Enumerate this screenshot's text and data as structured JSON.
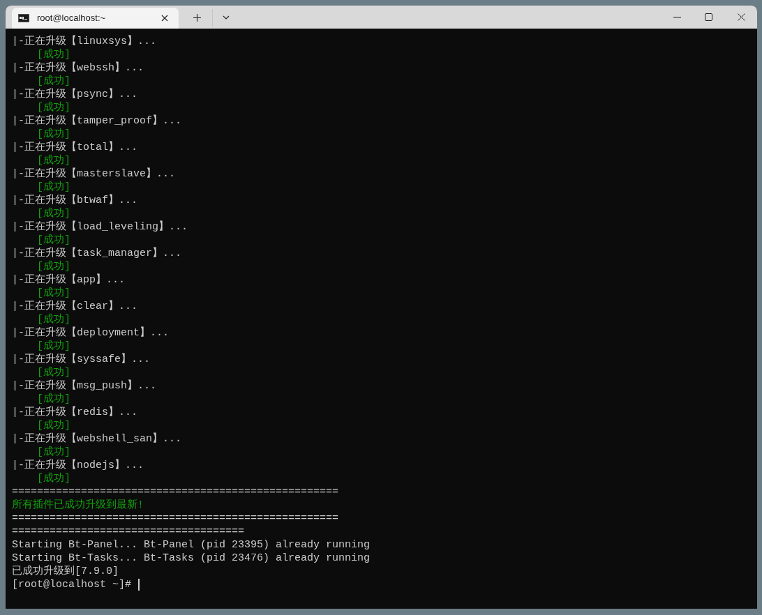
{
  "window": {
    "tab": {
      "title": "root@localhost:~",
      "selected": true
    }
  },
  "terminal": {
    "lines": [
      {
        "kind": "progress",
        "text": "|-正在升级【linuxsys】..."
      },
      {
        "kind": "status",
        "text": "[成功]"
      },
      {
        "kind": "progress",
        "text": "|-正在升级【webssh】..."
      },
      {
        "kind": "status",
        "text": "[成功]"
      },
      {
        "kind": "progress",
        "text": "|-正在升级【psync】..."
      },
      {
        "kind": "status",
        "text": "[成功]"
      },
      {
        "kind": "progress",
        "text": "|-正在升级【tamper_proof】..."
      },
      {
        "kind": "status",
        "text": "[成功]"
      },
      {
        "kind": "progress",
        "text": "|-正在升级【total】..."
      },
      {
        "kind": "status",
        "text": "[成功]"
      },
      {
        "kind": "progress",
        "text": "|-正在升级【masterslave】..."
      },
      {
        "kind": "status",
        "text": "[成功]"
      },
      {
        "kind": "progress",
        "text": "|-正在升级【btwaf】..."
      },
      {
        "kind": "status",
        "text": "[成功]"
      },
      {
        "kind": "progress",
        "text": "|-正在升级【load_leveling】..."
      },
      {
        "kind": "status",
        "text": "[成功]"
      },
      {
        "kind": "progress",
        "text": "|-正在升级【task_manager】..."
      },
      {
        "kind": "status",
        "text": "[成功]"
      },
      {
        "kind": "progress",
        "text": "|-正在升级【app】..."
      },
      {
        "kind": "status",
        "text": "[成功]"
      },
      {
        "kind": "progress",
        "text": "|-正在升级【clear】..."
      },
      {
        "kind": "status",
        "text": "[成功]"
      },
      {
        "kind": "progress",
        "text": "|-正在升级【deployment】..."
      },
      {
        "kind": "status",
        "text": "[成功]"
      },
      {
        "kind": "progress",
        "text": "|-正在升级【syssafe】..."
      },
      {
        "kind": "status",
        "text": "[成功]"
      },
      {
        "kind": "progress",
        "text": "|-正在升级【msg_push】..."
      },
      {
        "kind": "status",
        "text": "[成功]"
      },
      {
        "kind": "progress",
        "text": "|-正在升级【redis】..."
      },
      {
        "kind": "status",
        "text": "[成功]"
      },
      {
        "kind": "progress",
        "text": "|-正在升级【webshell_san】..."
      },
      {
        "kind": "status",
        "text": "[成功]"
      },
      {
        "kind": "progress",
        "text": "|-正在升级【nodejs】..."
      },
      {
        "kind": "status",
        "text": "[成功]"
      },
      {
        "kind": "rule",
        "text": "===================================================="
      },
      {
        "kind": "notice",
        "text": "所有插件已成功升级到最新!"
      },
      {
        "kind": "rule",
        "text": "===================================================="
      },
      {
        "kind": "rule",
        "text": "====================================="
      },
      {
        "kind": "output",
        "text": "Starting Bt-Panel... Bt-Panel (pid 23395) already running"
      },
      {
        "kind": "output",
        "text": "Starting Bt-Tasks... Bt-Tasks (pid 23476) already running"
      },
      {
        "kind": "output",
        "text": "已成功升级到[7.9.0]"
      },
      {
        "kind": "prompt",
        "text": "[root@localhost ~]#"
      }
    ]
  }
}
